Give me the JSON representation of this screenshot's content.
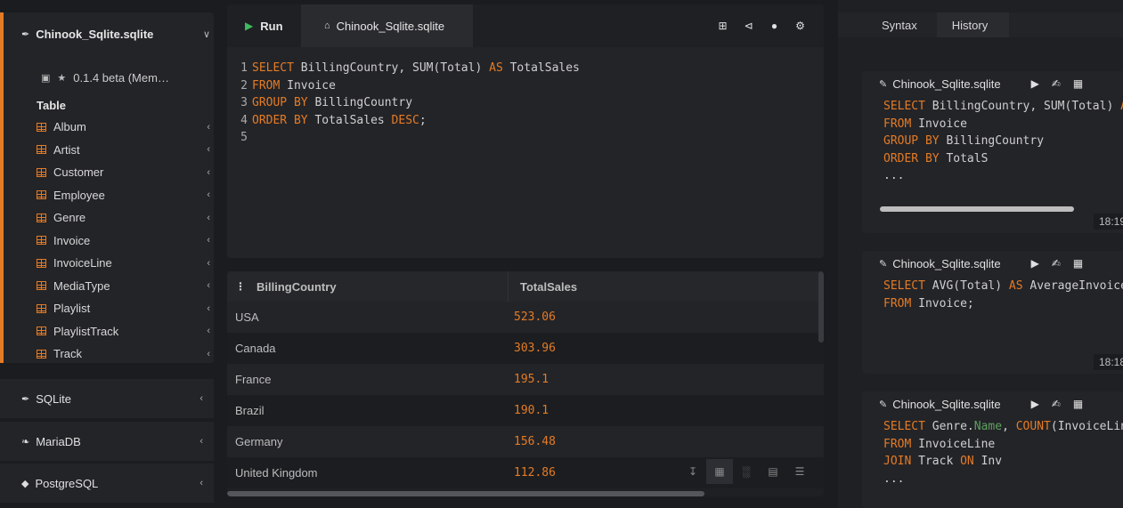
{
  "sidebar": {
    "active_db": {
      "name": "Chinook_Sqlite.sqlite",
      "version": "0.1.4 beta (Mem…",
      "section_label": "Table",
      "tables": [
        "Album",
        "Artist",
        "Customer",
        "Employee",
        "Genre",
        "Invoice",
        "InvoiceLine",
        "MediaType",
        "Playlist",
        "PlaylistTrack",
        "Track"
      ]
    },
    "other_dbs": [
      {
        "name": "SQLite",
        "icon": "feather-icon"
      },
      {
        "name": "MariaDB",
        "icon": "seal-icon"
      },
      {
        "name": "PostgreSQL",
        "icon": "elephant-icon"
      }
    ]
  },
  "editor": {
    "run_label": "Run",
    "tab_label": "Chinook_Sqlite.sqlite",
    "toolbar_icons": [
      "plus-square-icon",
      "share-icon",
      "user-icon",
      "gear-icon"
    ],
    "lines": [
      {
        "n": "1",
        "tokens": [
          [
            "kw",
            "SELECT"
          ],
          [
            "tx",
            " BillingCountry, SUM(Total) "
          ],
          [
            "kw",
            "AS"
          ],
          [
            "tx",
            " TotalSales"
          ]
        ]
      },
      {
        "n": "2",
        "tokens": [
          [
            "kw",
            "FROM"
          ],
          [
            "tx",
            " Invoice"
          ]
        ]
      },
      {
        "n": "3",
        "tokens": [
          [
            "kw",
            "GROUP BY"
          ],
          [
            "tx",
            " BillingCountry"
          ]
        ]
      },
      {
        "n": "4",
        "tokens": [
          [
            "kw",
            "ORDER BY"
          ],
          [
            "tx",
            " TotalSales "
          ],
          [
            "kw",
            "DESC"
          ],
          [
            "tx",
            ";"
          ]
        ]
      },
      {
        "n": "5",
        "tokens": []
      }
    ]
  },
  "results": {
    "columns": [
      "BillingCountry",
      "TotalSales"
    ],
    "rows": [
      [
        "USA",
        "523.06"
      ],
      [
        "Canada",
        "303.96"
      ],
      [
        "France",
        "195.1"
      ],
      [
        "Brazil",
        "190.1"
      ],
      [
        "Germany",
        "156.48"
      ],
      [
        "United Kingdom",
        "112.86"
      ]
    ],
    "tool_icons": [
      "download-icon",
      "table-icon",
      "bar-chart-icon",
      "book-icon",
      "menu-icon"
    ]
  },
  "history_panel": {
    "tabs": [
      "Syntax",
      "History"
    ],
    "active_tab": "History",
    "entries": [
      {
        "db": "Chinook_Sqlite.sqlite",
        "time": "18:19",
        "lines": [
          [
            [
              "kw",
              "SELECT"
            ],
            [
              "tx",
              " BillingCountry, SUM(Total) "
            ],
            [
              "kw",
              "AS"
            ]
          ],
          [
            [
              "kw",
              "FROM"
            ],
            [
              "tx",
              " Invoice"
            ]
          ],
          [
            [
              "kw",
              "GROUP BY"
            ],
            [
              "tx",
              " BillingCountry"
            ]
          ],
          [
            [
              "kw",
              "ORDER BY"
            ],
            [
              "tx",
              " TotalS"
            ]
          ],
          [
            [
              "tx",
              "..."
            ]
          ]
        ]
      },
      {
        "db": "Chinook_Sqlite.sqlite",
        "time": "18:18",
        "lines": [
          [
            [
              "kw",
              "SELECT"
            ],
            [
              "tx",
              " AVG(Total) "
            ],
            [
              "kw",
              "AS"
            ],
            [
              "tx",
              " AverageInvoice"
            ]
          ],
          [
            [
              "kw",
              "FROM"
            ],
            [
              "tx",
              " Invoice;"
            ]
          ]
        ]
      },
      {
        "db": "Chinook_Sqlite.sqlite",
        "time": "",
        "lines": [
          [
            [
              "kw",
              "SELECT"
            ],
            [
              "tx",
              " Genre."
            ],
            [
              "gr",
              "Name"
            ],
            [
              "tx",
              ", "
            ],
            [
              "kw",
              "COUNT"
            ],
            [
              "tx",
              "(InvoiceLin"
            ]
          ],
          [
            [
              "kw",
              "FROM"
            ],
            [
              "tx",
              " InvoiceLine"
            ]
          ],
          [
            [
              "kw",
              "JOIN"
            ],
            [
              "tx",
              " Track "
            ],
            [
              "kw",
              "ON"
            ],
            [
              "tx",
              " Inv"
            ]
          ],
          [
            [
              "tx",
              "..."
            ]
          ]
        ]
      }
    ]
  },
  "colors": {
    "accent": "#e47b25",
    "run_green": "#3dbb5e",
    "bg": "#1b1c1f"
  }
}
